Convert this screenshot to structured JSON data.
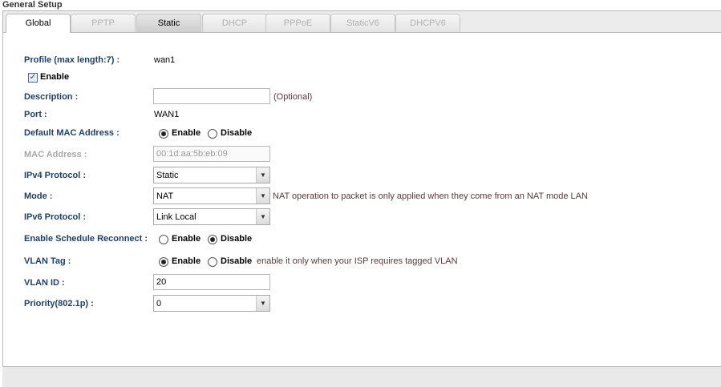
{
  "section_title": "General Setup",
  "tabs": [
    {
      "label": "Global",
      "state": "active"
    },
    {
      "label": "PPTP",
      "state": "disabled"
    },
    {
      "label": "Static",
      "state": "enabled"
    },
    {
      "label": "DHCP",
      "state": "disabled"
    },
    {
      "label": "PPPoE",
      "state": "disabled"
    },
    {
      "label": "StaticV6",
      "state": "disabled"
    },
    {
      "label": "DHCPV6",
      "state": "disabled"
    }
  ],
  "profile": {
    "label": "Profile (max length:7) :",
    "value": "wan1"
  },
  "enable_checkbox": {
    "label": "Enable",
    "checked": true
  },
  "description": {
    "label": "Description :",
    "value": "",
    "hint": "(Optional)"
  },
  "port": {
    "label": "Port :",
    "value": "WAN1"
  },
  "default_mac": {
    "label": "Default MAC Address :",
    "option_enable": "Enable",
    "option_disable": "Disable",
    "selected": "Enable"
  },
  "mac_address": {
    "label": "MAC Address :",
    "value": "00:1d:aa:5b:eb:09"
  },
  "ipv4_protocol": {
    "label": "IPv4 Protocol :",
    "value": "Static"
  },
  "mode": {
    "label": "Mode :",
    "value": "NAT",
    "hint": "NAT operation to packet is only applied when they come from an NAT mode LAN"
  },
  "ipv6_protocol": {
    "label": "IPv6 Protocol :",
    "value": "Link Local"
  },
  "schedule_reconnect": {
    "label": "Enable Schedule Reconnect :",
    "option_enable": "Enable",
    "option_disable": "Disable",
    "selected": "Disable"
  },
  "vlan_tag": {
    "label": "VLAN Tag :",
    "option_enable": "Enable",
    "option_disable": "Disable",
    "selected": "Enable",
    "hint": "enable it only when your ISP requires tagged VLAN"
  },
  "vlan_id": {
    "label": "VLAN ID :",
    "value": "20"
  },
  "priority": {
    "label": "Priority(802.1p) :",
    "value": "0"
  },
  "colors": {
    "label_blue": "#1f3f6b",
    "disabled_gray": "#a8a8a8",
    "hint_brown": "#5a3a3a"
  }
}
